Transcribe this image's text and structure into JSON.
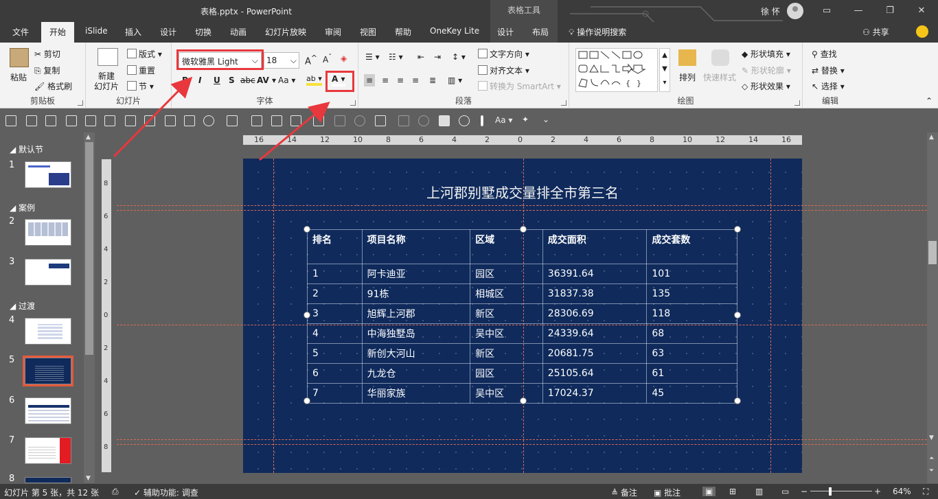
{
  "titlebar": {
    "document": "表格.pptx",
    "app": "PowerPoint",
    "contextual": "表格工具",
    "user": "徐 怀"
  },
  "tabs": [
    "文件",
    "开始",
    "iSlide",
    "插入",
    "设计",
    "切换",
    "动画",
    "幻灯片放映",
    "审阅",
    "视图",
    "帮助",
    "OneKey Lite",
    "设计",
    "布局"
  ],
  "tell_me": "操作说明搜索",
  "share": "共享",
  "ribbon": {
    "clipboard": {
      "paste": "粘贴",
      "cut": "剪切",
      "copy": "复制",
      "format_painter": "格式刷",
      "label": "剪贴板"
    },
    "slides": {
      "new_slide": "新建\n幻灯片",
      "layout": "版式",
      "reset": "重置",
      "section": "节",
      "label": "幻灯片"
    },
    "font": {
      "name": "微软雅黑 Light",
      "size": "18",
      "label": "字体"
    },
    "paragraph": {
      "text_direction": "文字方向",
      "align_text": "对齐文本",
      "smartart": "转换为 SmartArt",
      "label": "段落"
    },
    "drawing": {
      "arrange": "排列",
      "quick_styles": "快速样式",
      "fill": "形状填充",
      "outline": "形状轮廓",
      "effects": "形状效果",
      "label": "绘图"
    },
    "editing": {
      "find": "查找",
      "replace": "替换",
      "select": "选择",
      "label": "编辑"
    }
  },
  "thumbnails": {
    "sections": [
      "默认节",
      "案例",
      "过渡"
    ],
    "numbers": [
      "1",
      "2",
      "3",
      "4",
      "5",
      "6",
      "7",
      "8"
    ],
    "selected": "5"
  },
  "ruler": {
    "h_labels": [
      "16",
      "14",
      "12",
      "10",
      "8",
      "6",
      "4",
      "2",
      "0",
      "2",
      "4",
      "6",
      "8",
      "10",
      "12",
      "14",
      "16"
    ],
    "v_labels": [
      "8",
      "6",
      "4",
      "2",
      "0",
      "2",
      "4",
      "6",
      "8"
    ]
  },
  "slide": {
    "title": "上河郡别墅成交量排全市第三名",
    "headers": [
      "排名",
      "项目名称",
      "区域",
      "成交面积",
      "成交套数"
    ],
    "rows": [
      [
        "1",
        "阿卡迪亚",
        "园区",
        "36391.64",
        "101"
      ],
      [
        "2",
        "91栋",
        "相城区",
        "31837.38",
        "135"
      ],
      [
        "3",
        "旭辉上河郡",
        "新区",
        "28306.69",
        "118"
      ],
      [
        "4",
        "中海独墅岛",
        "吴中区",
        "24339.64",
        "68"
      ],
      [
        "5",
        "新创大河山",
        "新区",
        "20681.75",
        "63"
      ],
      [
        "6",
        "九龙仓",
        "园区",
        "25105.64",
        "61"
      ],
      [
        "7",
        "华丽家族",
        "吴中区",
        "17024.37",
        "45"
      ]
    ]
  },
  "status": {
    "slide_info": "幻灯片 第 5 张，共 12 张",
    "accessibility": "辅助功能: 调查",
    "notes": "备注",
    "comments": "批注",
    "zoom": "64%"
  },
  "colors": {
    "accent": "#e8383d",
    "slide_bg": "#0f2a5b",
    "guide": "#e06a55"
  }
}
